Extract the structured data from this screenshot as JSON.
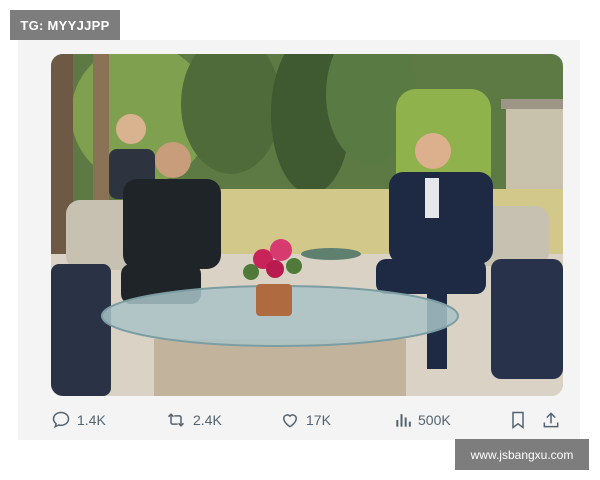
{
  "watermark_top": "TG: MYYJJPP",
  "watermark_bottom": "www.jsbangxu.com",
  "post": {
    "image_alt": "Meeting photo on a terrace",
    "actions": {
      "reply": {
        "icon": "comment-icon",
        "count": "1.4K"
      },
      "repost": {
        "icon": "repost-icon",
        "count": "2.4K"
      },
      "like": {
        "icon": "heart-icon",
        "count": "17K"
      },
      "views": {
        "icon": "bar-chart-icon",
        "count": "500K"
      },
      "bookmark": {
        "icon": "bookmark-icon"
      },
      "share": {
        "icon": "share-icon"
      }
    }
  },
  "colors": {
    "action_gray": "#536471",
    "watermark_bg": "#7d7d7d",
    "card_bg": "#f4f4f4"
  }
}
